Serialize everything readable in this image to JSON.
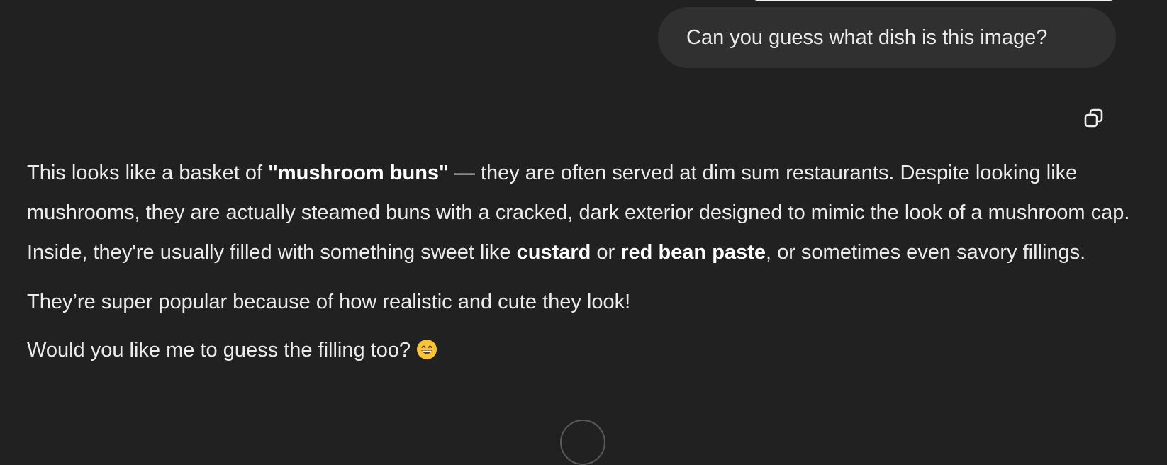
{
  "user_message": {
    "text": "Can you guess what dish is this image?"
  },
  "actions": {
    "copy_icon": "copy-icon"
  },
  "assistant": {
    "p1": {
      "t1": "This looks like a basket of ",
      "b1": "\"mushroom buns\"",
      "t2": " — they are often served at dim sum restaurants. Despite looking like mushrooms, they are actually steamed buns with a cracked, dark exterior designed to mimic the look of a mushroom cap. Inside, they're usually filled with something sweet like ",
      "b2": "custard",
      "t3": " or ",
      "b3": "red bean paste",
      "t4": ", or sometimes even savory fillings."
    },
    "p2": "They’re super popular because of how realistic and cute they look!",
    "p3": "Would you like me to guess the filling too? ",
    "emoji": "grinning-face-emoji"
  },
  "colors": {
    "background": "#212121",
    "user_bubble": "#303030",
    "text": "#ececec"
  }
}
